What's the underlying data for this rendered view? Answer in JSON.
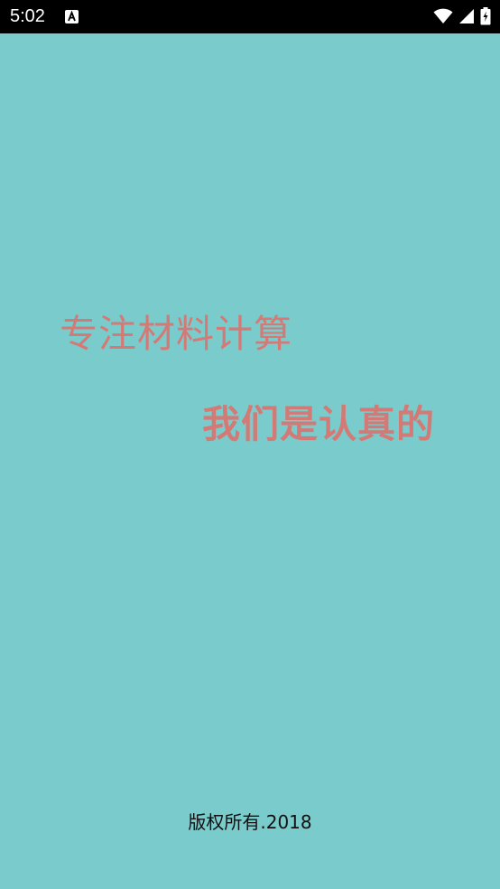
{
  "status_bar": {
    "time": "5:02",
    "icons": [
      "font-app-notification-icon",
      "wifi-icon",
      "cellular-signal-icon",
      "battery-charging-icon"
    ]
  },
  "splash": {
    "slogan_line_1": "专注材料计算",
    "slogan_line_2": "我们是认真的",
    "copyright": "版权所有.2018"
  },
  "colors": {
    "background": "#7acbcc",
    "slogan": "#d47a76",
    "status_bar": "#000000"
  }
}
